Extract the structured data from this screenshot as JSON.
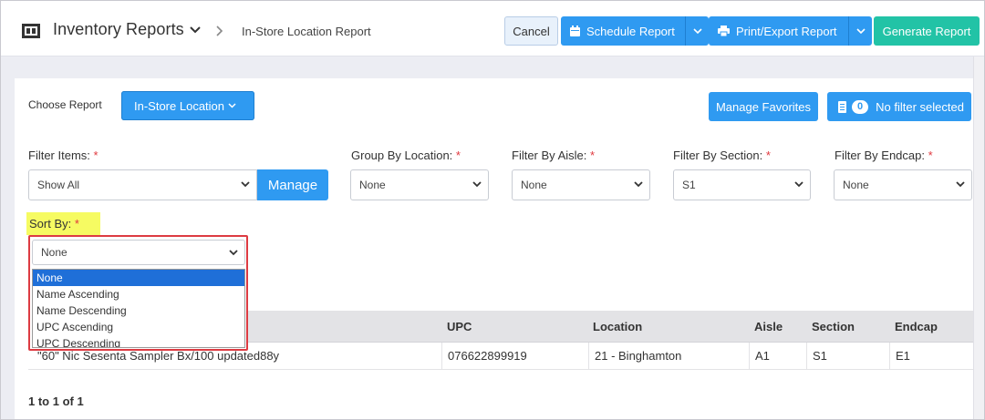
{
  "header": {
    "app_title": "Inventory Reports",
    "breadcrumb": "In-Store Location Report",
    "cancel_label": "Cancel",
    "schedule_label": "Schedule Report",
    "print_label": "Print/Export Report",
    "generate_label": "Generate Report"
  },
  "toolbar": {
    "choose_label": "Choose Report",
    "report_selected": "In-Store Location",
    "favorites_label": "Manage Favorites",
    "filter_count": "0",
    "filter_label": "No filter selected"
  },
  "filters": {
    "items": {
      "label": "Filter Items:",
      "value": "Show All",
      "manage_label": "Manage"
    },
    "group": {
      "label": "Group By Location:",
      "value": "None"
    },
    "aisle": {
      "label": "Filter By Aisle:",
      "value": "None"
    },
    "section": {
      "label": "Filter By Section:",
      "value": "S1"
    },
    "endcap": {
      "label": "Filter By Endcap:",
      "value": "None"
    },
    "required_mark": "*"
  },
  "sort": {
    "label": "Sort By:",
    "value": "None",
    "options": [
      "None",
      "Name Ascending",
      "Name Descending",
      "UPC Ascending",
      "UPC Descending"
    ]
  },
  "table": {
    "headers": {
      "upc": "UPC",
      "location": "Location",
      "aisle": "Aisle",
      "section": "Section",
      "endcap": "Endcap"
    },
    "rows": [
      {
        "name": "\"60\" Nic Sesenta Sampler Bx/100 updated88y",
        "upc": "076622899919",
        "location": "21 - Binghamton",
        "aisle": "A1",
        "section": "S1",
        "endcap": "E1"
      }
    ]
  },
  "pager": "1 to 1 of 1",
  "colors": {
    "primary": "#2f9af1",
    "teal": "#22c3a6",
    "highlight": "#f6fb62",
    "outline": "#dd3b42"
  }
}
